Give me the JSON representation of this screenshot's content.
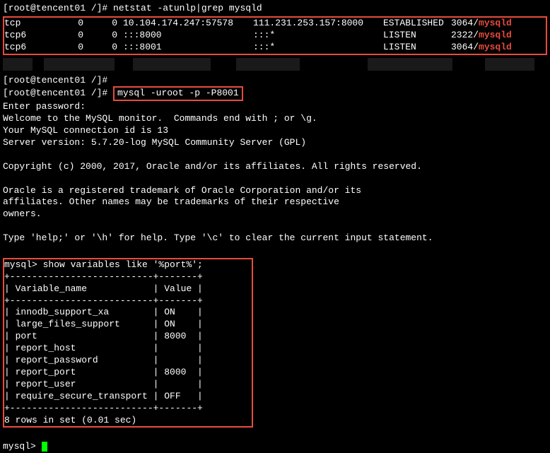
{
  "prompt1": "[root@tencent01 /]# ",
  "cmd1": "netstat -atunlp|grep mysqld",
  "netstat": {
    "rows": [
      {
        "proto": "tcp",
        "recvq": "0",
        "sendq": "0",
        "local": "10.104.174.247:57578",
        "foreign": "111.231.253.157:8000",
        "state": "ESTABLISHED",
        "pid": "3064/",
        "prog": "mysqld"
      },
      {
        "proto": "tcp6",
        "recvq": "0",
        "sendq": "0",
        "local": ":::8000",
        "foreign": ":::*",
        "state": "LISTEN",
        "pid": "2322/",
        "prog": "mysqld"
      },
      {
        "proto": "tcp6",
        "recvq": "0",
        "sendq": "0",
        "local": ":::8001",
        "foreign": ":::*",
        "state": "LISTEN",
        "pid": "3064/",
        "prog": "mysqld"
      }
    ]
  },
  "prompt2": "[root@tencent01 /]#",
  "prompt3": "[root@tencent01 /]# ",
  "cmd2": "mysql -uroot -p -P8001",
  "welcome": {
    "l1": "Enter password:",
    "l2": "Welcome to the MySQL monitor.  Commands end with ; or \\g.",
    "l3": "Your MySQL connection id is 13",
    "l4": "Server version: 5.7.20-log MySQL Community Server (GPL)",
    "l5": "Copyright (c) 2000, 2017, Oracle and/or its affiliates. All rights reserved.",
    "l6": "Oracle is a registered trademark of Oracle Corporation and/or its",
    "l7": "affiliates. Other names may be trademarks of their respective",
    "l8": "owners.",
    "l9": "Type 'help;' or '\\h' for help. Type '\\c' to clear the current input statement."
  },
  "mysql": {
    "prompt": "mysql> ",
    "query": "show variables like '%port%';",
    "sep1": "+--------------------------+-------+",
    "header": "| Variable_name            | Value |",
    "sep2": "+--------------------------+-------+",
    "rows": [
      "| innodb_support_xa        | ON    |",
      "| large_files_support      | ON    |",
      "| port                     | 8000  |",
      "| report_host              |       |",
      "| report_password          |       |",
      "| report_port              | 8000  |",
      "| report_user              |       |",
      "| require_secure_transport | OFF   |"
    ],
    "sep3": "+--------------------------+-------+",
    "result": "8 rows in set (0.01 sec)"
  },
  "chart_data": {
    "type": "table",
    "title": "show variables like '%port%'",
    "columns": [
      "Variable_name",
      "Value"
    ],
    "rows": [
      [
        "innodb_support_xa",
        "ON"
      ],
      [
        "large_files_support",
        "ON"
      ],
      [
        "port",
        "8000"
      ],
      [
        "report_host",
        ""
      ],
      [
        "report_password",
        ""
      ],
      [
        "report_port",
        "8000"
      ],
      [
        "report_user",
        ""
      ],
      [
        "require_secure_transport",
        "OFF"
      ]
    ]
  }
}
